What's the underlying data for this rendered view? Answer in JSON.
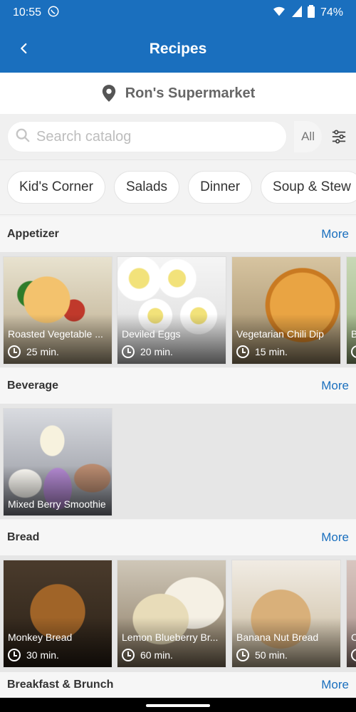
{
  "status": {
    "time": "10:55",
    "battery": "74%"
  },
  "appbar": {
    "title": "Recipes"
  },
  "store": {
    "name": "Ron's Supermarket"
  },
  "search": {
    "placeholder": "Search catalog",
    "scope": "All"
  },
  "categories": [
    "Kid's Corner",
    "Salads",
    "Dinner",
    "Soup & Stew"
  ],
  "sections": [
    {
      "title": "Appetizer",
      "more": "More",
      "cards": [
        {
          "name": "Roasted Vegetable ...",
          "time": "25 min."
        },
        {
          "name": "Deviled Eggs",
          "time": "20 min."
        },
        {
          "name": "Vegetarian Chili  Dip",
          "time": "15 min."
        },
        {
          "name": "B",
          "time": ""
        }
      ]
    },
    {
      "title": "Beverage",
      "more": "More",
      "cards": [
        {
          "name": "Mixed Berry Smoothie",
          "time": ""
        }
      ]
    },
    {
      "title": "Bread",
      "more": "More",
      "cards": [
        {
          "name": "Monkey Bread",
          "time": "30 min."
        },
        {
          "name": "Lemon Blueberry Br...",
          "time": "60 min."
        },
        {
          "name": "Banana Nut Bread",
          "time": "50 min."
        },
        {
          "name": "C",
          "time": ""
        }
      ]
    },
    {
      "title": "Breakfast & Brunch",
      "more": "More"
    }
  ],
  "icons": {
    "back": "chevron-left-icon",
    "location": "map-pin-icon",
    "search": "search-icon",
    "filter": "filter-sliders-icon",
    "clock": "clock-icon"
  }
}
